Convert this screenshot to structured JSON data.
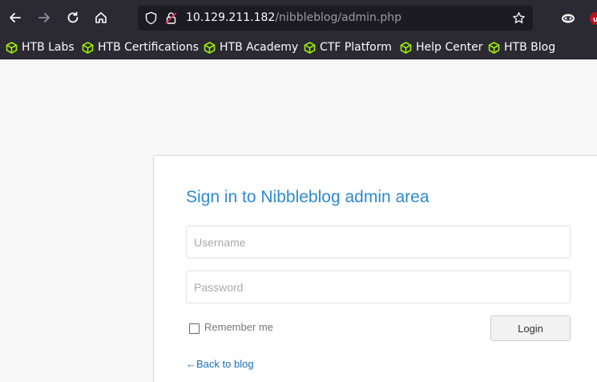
{
  "browser": {
    "url_host": "10.129.211.182",
    "url_path": "/nibbleblog/admin.php",
    "bookmarks": [
      {
        "label": "HTB Labs",
        "icon": "hackthebox-cube-icon"
      },
      {
        "label": "HTB Certifications",
        "icon": "hackthebox-cube-icon"
      },
      {
        "label": "HTB Academy",
        "icon": "hackthebox-cube-icon"
      },
      {
        "label": "CTF Platform",
        "icon": "hackthebox-cube-icon"
      },
      {
        "label": "Help Center",
        "icon": "hackthebox-cube-icon"
      },
      {
        "label": "HTB Blog",
        "icon": "hackthebox-cube-icon"
      }
    ],
    "bookmark_icon_color": "#9fef00"
  },
  "login": {
    "title": "Sign in to Nibbleblog admin area",
    "username_placeholder": "Username",
    "password_placeholder": "Password",
    "remember_label": "Remember me",
    "login_button": "Login",
    "back_link": "←Back to blog"
  },
  "colors": {
    "accent": "#2d8ad1",
    "link": "#1a6fb8"
  }
}
